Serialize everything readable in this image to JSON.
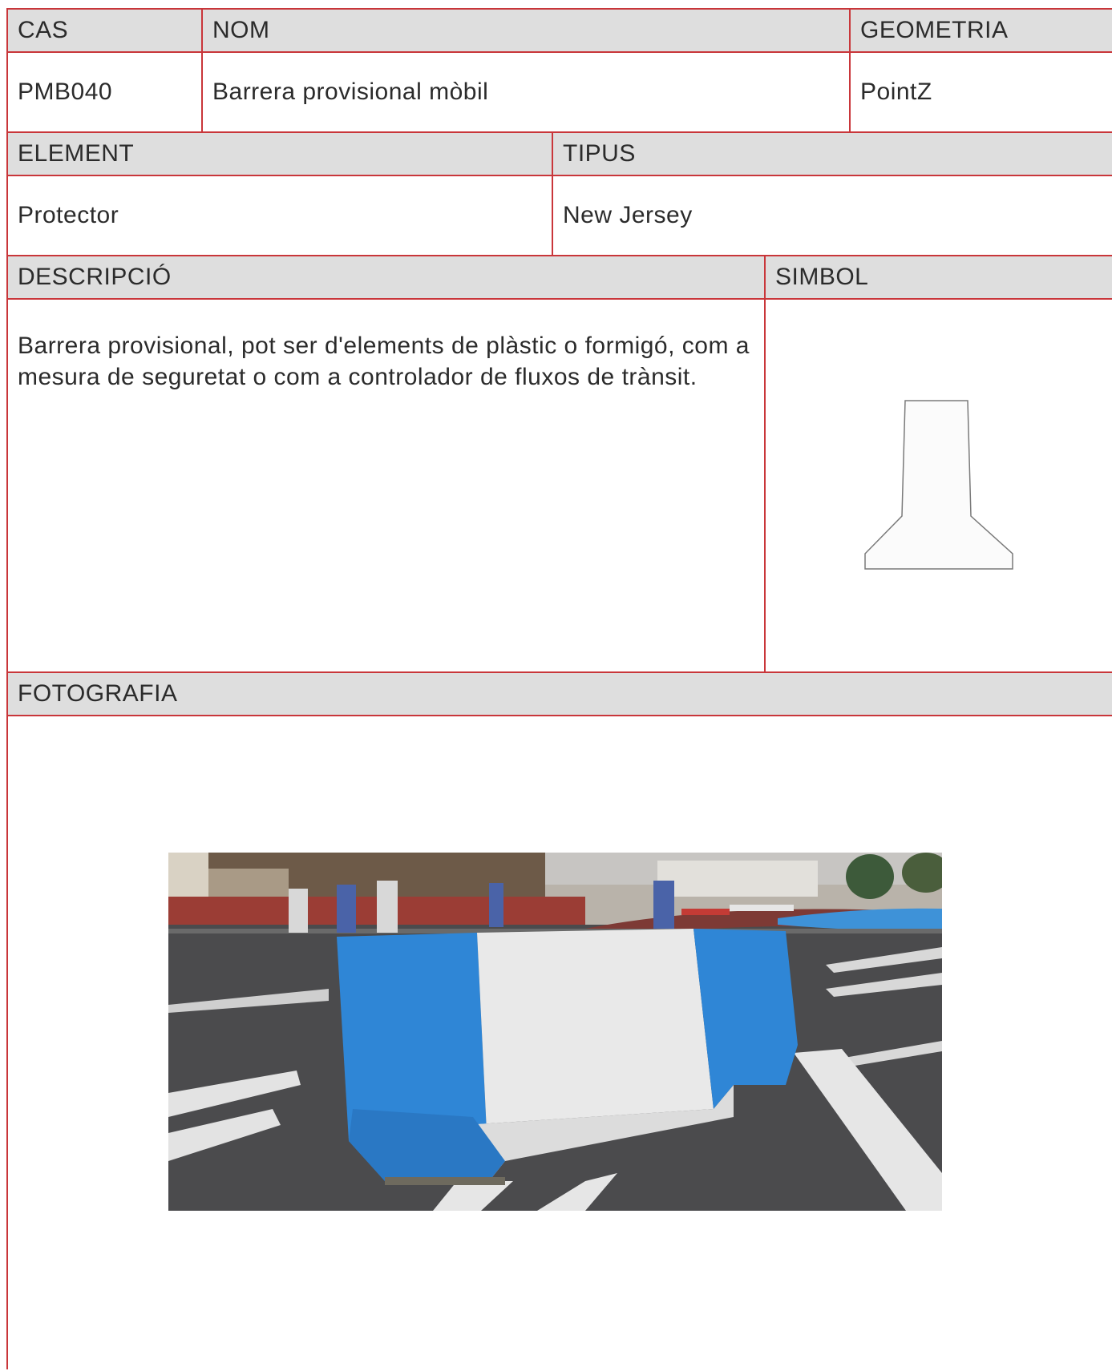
{
  "row1": {
    "cas_label": "CAS",
    "nom_label": "NOM",
    "geometria_label": "GEOMETRIA",
    "cas_value": "PMB040",
    "nom_value": "Barrera provisional mòbil",
    "geometria_value": "PointZ"
  },
  "row2": {
    "element_label": "ELEMENT",
    "tipus_label": "TIPUS",
    "element_value": "Protector",
    "tipus_value": "New Jersey"
  },
  "row3": {
    "descripcio_label": "DESCRIPCIÓ",
    "simbol_label": "SIMBOL",
    "descripcio_value": "Barrera provisional, pot ser d'elements de plàstic o formigó, com a mesura de seguretat o com a controlador de fluxos de trànsit."
  },
  "row4": {
    "fotografia_label": "FOTOGRAFIA"
  },
  "colors": {
    "border": "#c9363a",
    "header_bg": "#dedede",
    "barrier_blue": "#2f86d6",
    "barrier_white": "#e9e9e9"
  }
}
